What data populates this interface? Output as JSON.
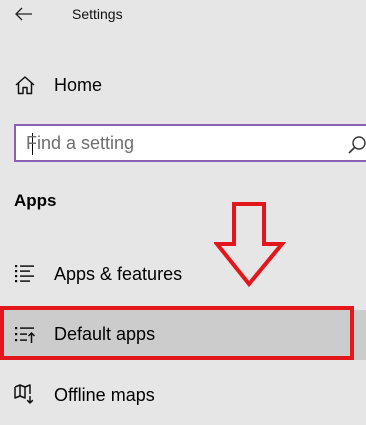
{
  "header": {
    "title": "Settings",
    "back_icon": "back-arrow-icon"
  },
  "home": {
    "label": "Home",
    "icon": "home-icon"
  },
  "search": {
    "placeholder": "Find a setting",
    "value": "",
    "icon": "search-icon"
  },
  "section": {
    "heading": "Apps"
  },
  "nav_items": [
    {
      "label": "Apps & features",
      "icon": "apps-features-icon",
      "selected": false
    },
    {
      "label": "Default apps",
      "icon": "default-apps-icon",
      "selected": true
    },
    {
      "label": "Offline maps",
      "icon": "offline-maps-icon",
      "selected": false
    }
  ],
  "annotation": {
    "arrow_color": "#e3161b",
    "highlight_color": "#e3161b"
  },
  "colors": {
    "background": "#e6e6e6",
    "selected_row": "#cccccc",
    "search_border": "#8a60b5"
  }
}
